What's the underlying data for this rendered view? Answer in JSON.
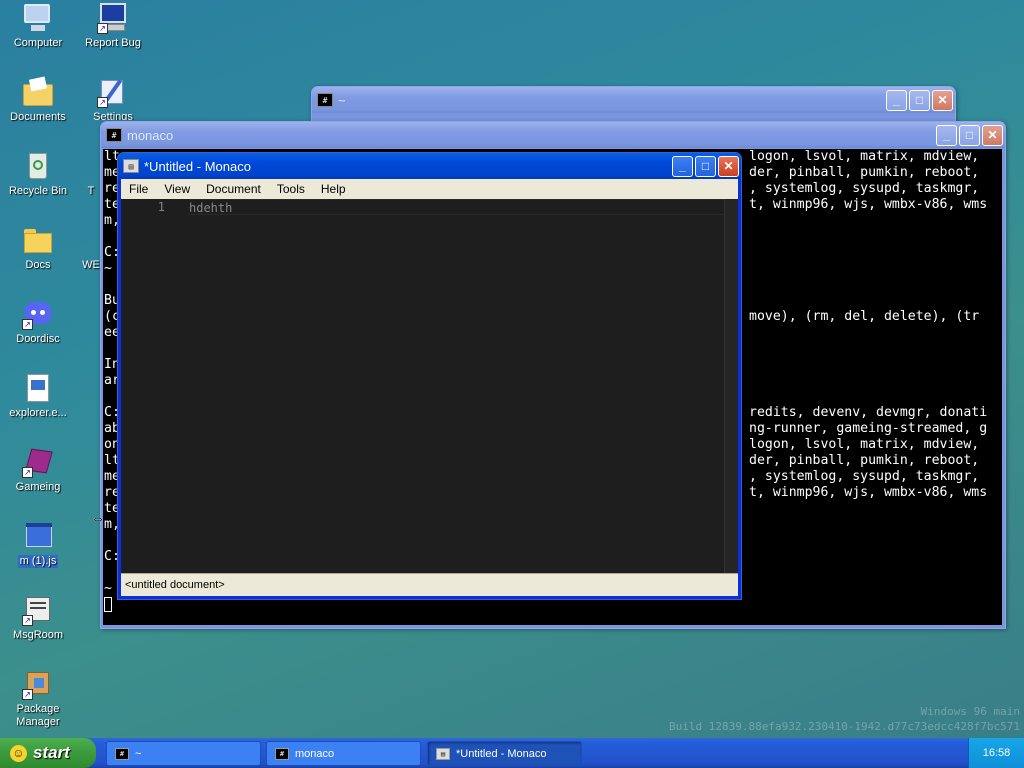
{
  "desktop": {
    "icons": [
      {
        "label": "Computer"
      },
      {
        "label": "Report Bug"
      },
      {
        "label": "Documents"
      },
      {
        "label": "Settings"
      },
      {
        "label": "Recycle Bin"
      },
      {
        "label": "T"
      },
      {
        "label": "Docs"
      },
      {
        "label": "WE"
      },
      {
        "label": "Doordisc"
      },
      {
        "label": "explorer.e..."
      },
      {
        "label": "Gameing"
      },
      {
        "label": "m (1).js"
      },
      {
        "label": "MsgRoom"
      },
      {
        "label": "Package Manager"
      }
    ]
  },
  "windows": {
    "back_terminal": {
      "title": "~",
      "icon": "#"
    },
    "monaco_terminal": {
      "title": "monaco",
      "icon": "#",
      "left_lines": [
        "lt",
        "me",
        "re",
        "te",
        "m,",
        "",
        "C:",
        "~",
        "",
        "Bu",
        "(c",
        "ee",
        "",
        "In",
        "ar",
        "",
        "C:",
        "ab",
        "on",
        "lt",
        "me",
        "re",
        "te",
        "m,",
        "",
        "C:",
        "",
        "~"
      ],
      "right_lines": [
        "logon, lsvol, matrix, mdview,",
        "der, pinball, pumkin, reboot,",
        ", systemlog, sysupd, taskmgr,",
        "t, winmp96, wjs, wmbx-v86, wms",
        "",
        "",
        "",
        "",
        "",
        "",
        "move), (rm, del, delete), (tr",
        "",
        "",
        "",
        "",
        "",
        "redits, devenv, devmgr, donati",
        "ng-runner, gameing-streamed, g",
        "logon, lsvol, matrix, mdview,",
        "der, pinball, pumkin, reboot,",
        ", systemlog, sysupd, taskmgr,",
        "t, winmp96, wjs, wmbx-v86, wms"
      ]
    },
    "editor": {
      "title": "*Untitled - Monaco",
      "menu": [
        "File",
        "View",
        "Document",
        "Tools",
        "Help"
      ],
      "line_number": "1",
      "code": "hdehth",
      "status": "<untitled document>"
    }
  },
  "watermark": {
    "line1": "Windows 96 main",
    "line2": "Build 12839.88efa932.230410-1942.d77c73edcc428f7bc571"
  },
  "taskbar": {
    "start_label": "start",
    "items": [
      {
        "label": "~"
      },
      {
        "label": "monaco"
      },
      {
        "label": "*Untitled - Monaco"
      }
    ],
    "clock": "16:58"
  },
  "colors": {
    "titlebar_active": "#0a5fe6",
    "titlebar_inactive": "#7a96df",
    "taskbar": "#245edb",
    "start": "#3c9a3c"
  }
}
